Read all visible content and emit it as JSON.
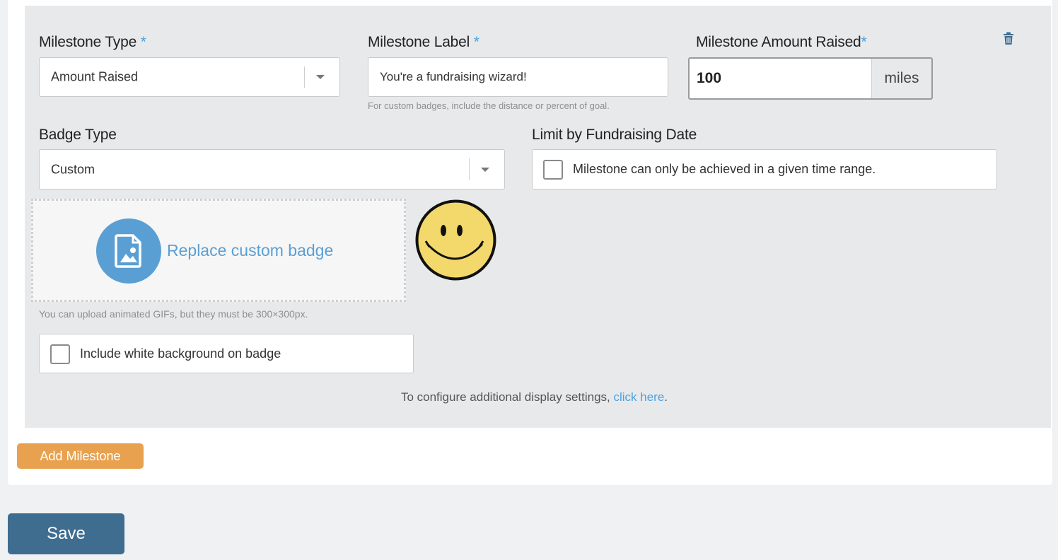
{
  "milestone": {
    "type_label": "Milestone Type",
    "type_value": "Amount Raised",
    "label_label": "Milestone Label",
    "label_value": "You're a fundraising wizard!",
    "label_help": "For custom badges, include the distance or percent of goal.",
    "amount_label": "Milestone Amount Raised",
    "amount_value": "100",
    "amount_unit": "miles",
    "required_mark": "*"
  },
  "badge": {
    "type_label": "Badge Type",
    "type_value": "Custom",
    "replace_label": "Replace custom badge",
    "upload_help": "You can upload animated GIFs, but they must be 300×300px.",
    "white_bg_label": "Include white background on badge",
    "white_bg_checked": false
  },
  "limit": {
    "label": "Limit by Fundraising Date",
    "checkbox_label": "Milestone can only be achieved in a given time range.",
    "checked": false
  },
  "config": {
    "text": "To configure additional display settings, ",
    "link": "click here",
    "suffix": "."
  },
  "actions": {
    "add_milestone": "Add Milestone",
    "save": "Save"
  },
  "icons": {
    "delete": "trash-icon",
    "upload": "image-file-icon",
    "badge_preview": "smiley-face"
  },
  "colors": {
    "accent_blue": "#4aa3df",
    "add_button": "#e8a14f",
    "save_button": "#3f6d90",
    "badge_circle": "#5a9fd4",
    "smiley_fill": "#f3d96b"
  }
}
